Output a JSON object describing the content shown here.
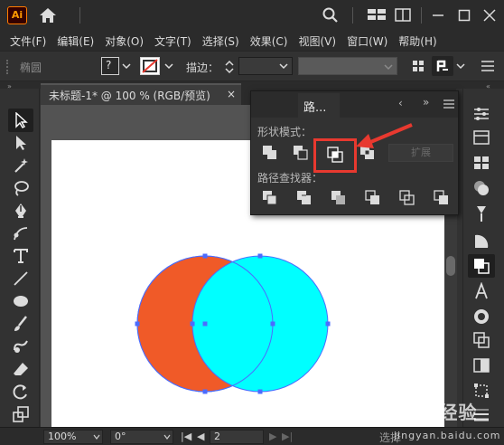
{
  "app": {
    "logo_text": "Ai"
  },
  "menu": [
    "文件(F)",
    "编辑(E)",
    "对象(O)",
    "文字(T)",
    "选择(S)",
    "效果(C)",
    "视图(V)",
    "窗口(W)",
    "帮助(H)"
  ],
  "control_bar": {
    "object_type": "椭圆",
    "fill_value": "?",
    "stroke_label": "描边："
  },
  "document": {
    "tab_label": "未标题-1* @ 100 % (RGB/预览)",
    "close_glyph": "×"
  },
  "pathfinder_panel": {
    "tab_label": "路...",
    "shape_modes_label": "形状模式：",
    "pathfinders_label": "路径查找器：",
    "expand_label": "扩展",
    "selected_mode": "intersect"
  },
  "artwork": {
    "left_circle_color": "#f05a28",
    "right_circle_color": "#00ffff",
    "selection_color": "#4b6cff",
    "annotation_color": "#e8392f"
  },
  "status_bar": {
    "zoom": "100%",
    "rotation": "0°",
    "artboard_number": "2",
    "tool_status": "选择"
  },
  "watermark": {
    "text": "Bai",
    "text2": "经验",
    "sub": "jingyan.baidu.com"
  }
}
